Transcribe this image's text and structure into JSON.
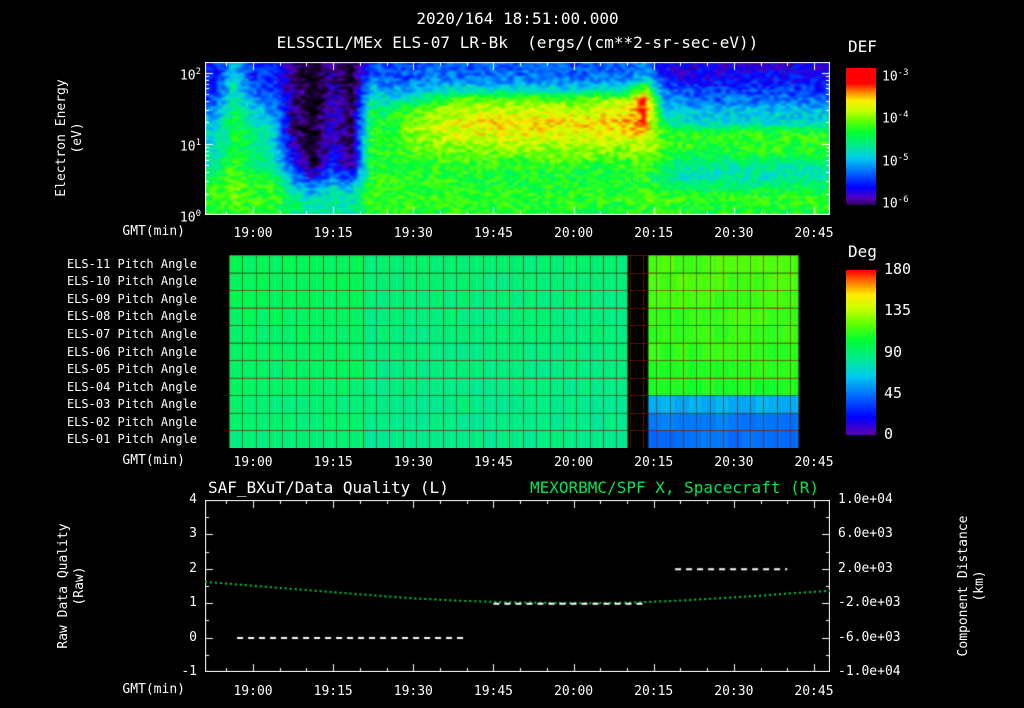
{
  "header": {
    "datetime": "2020/164 18:51:00.000",
    "plot_title": "ELSSCIL/MEx ELS-07 LR-Bk  (ergs/(cm**2-sr-sec-eV))"
  },
  "colors": {
    "background": "#000000",
    "text": "#ffffff",
    "title_green": "#00e64d",
    "curve_green": "#00cc44",
    "quality_white": "#ffffff",
    "grid_red": "#8a1e00"
  },
  "time_axis": {
    "label": "GMT(min)",
    "start": "18:51",
    "end": "20:48",
    "total_minutes": 117,
    "ticks": [
      {
        "t": 9,
        "label": "19:00"
      },
      {
        "t": 24,
        "label": "19:15"
      },
      {
        "t": 39,
        "label": "19:30"
      },
      {
        "t": 54,
        "label": "19:45"
      },
      {
        "t": 69,
        "label": "20:00"
      },
      {
        "t": 84,
        "label": "20:15"
      },
      {
        "t": 99,
        "label": "20:30"
      },
      {
        "t": 114,
        "label": "20:45"
      }
    ],
    "minor_step_min": 5
  },
  "chart_data": [
    {
      "type": "heatmap",
      "title": "ELSSCIL/MEx ELS-07 LR-Bk",
      "units": "ergs/(cm**2-sr-sec-eV)",
      "ylabel": "Electron Energy (eV)",
      "ylabel_lines": [
        "Electron Energy",
        "(eV)"
      ],
      "y_scale": "log",
      "y_range_log10": [
        0,
        2.15
      ],
      "y_ticks": [
        {
          "base": "10",
          "exp": "2",
          "log10": 2
        },
        {
          "base": "10",
          "exp": "1",
          "log10": 1
        },
        {
          "base": "10",
          "exp": "0",
          "log10": 0
        }
      ],
      "colorbar": {
        "label": "DEF",
        "scale": "log",
        "range_log10": [
          -6.1,
          -2.85
        ],
        "ticks": [
          {
            "base": "10",
            "exp": "-3",
            "value": -3
          },
          {
            "base": "10",
            "exp": "-4",
            "value": -4
          },
          {
            "base": "10",
            "exp": "-5",
            "value": -5
          },
          {
            "base": "10",
            "exp": "-6",
            "value": -6
          }
        ]
      },
      "grid_log10_flux": {
        "comment": "log10 DEF, 14 energy rows (top=highest E ~160eV, bottom ~1eV) x 32 time cols over 18:51-20:48",
        "n_time": 32,
        "n_energy": 14,
        "values_rows_top_to_bottom": [
          [
            -5.6,
            -5.0,
            -5.6,
            -5.6,
            -6.0,
            -6.3,
            -6.0,
            -6.3,
            -5.4,
            -5.5,
            -5.5,
            -5.4,
            -5.4,
            -5.4,
            -5.4,
            -5.4,
            -5.4,
            -5.4,
            -5.4,
            -5.4,
            -5.4,
            -5.4,
            -5.2,
            -5.7,
            -5.8,
            -5.8,
            -5.8,
            -5.8,
            -5.8,
            -5.8,
            -5.8,
            -5.8
          ],
          [
            -5.6,
            -4.9,
            -5.6,
            -5.6,
            -6.0,
            -6.3,
            -6.0,
            -6.3,
            -5.3,
            -5.4,
            -5.4,
            -5.3,
            -5.3,
            -5.3,
            -5.3,
            -5.3,
            -5.3,
            -5.3,
            -5.3,
            -5.3,
            -5.3,
            -5.3,
            -5.0,
            -5.6,
            -5.7,
            -5.7,
            -5.7,
            -5.7,
            -5.7,
            -5.7,
            -5.7,
            -5.7
          ],
          [
            -5.5,
            -4.8,
            -5.4,
            -5.5,
            -6.0,
            -6.3,
            -5.9,
            -6.2,
            -5.0,
            -5.2,
            -5.1,
            -5.0,
            -4.9,
            -4.8,
            -4.9,
            -4.9,
            -4.9,
            -4.9,
            -4.9,
            -4.9,
            -4.8,
            -4.8,
            -4.0,
            -5.4,
            -5.5,
            -5.5,
            -5.5,
            -5.5,
            -5.5,
            -5.5,
            -5.5,
            -5.5
          ],
          [
            -5.4,
            -4.7,
            -5.2,
            -5.4,
            -6.0,
            -6.3,
            -5.9,
            -6.2,
            -4.7,
            -4.9,
            -4.7,
            -4.4,
            -4.2,
            -4.1,
            -4.1,
            -4.1,
            -4.1,
            -4.1,
            -4.1,
            -4.1,
            -4.0,
            -3.9,
            -3.3,
            -5.1,
            -5.3,
            -5.3,
            -5.3,
            -5.3,
            -5.3,
            -5.3,
            -5.3,
            -5.3
          ],
          [
            -5.2,
            -4.5,
            -5.0,
            -5.2,
            -6.0,
            -6.3,
            -5.8,
            -6.2,
            -4.5,
            -4.5,
            -4.2,
            -4.0,
            -3.9,
            -3.85,
            -3.8,
            -3.8,
            -3.8,
            -3.8,
            -3.8,
            -3.8,
            -3.7,
            -3.65,
            -3.25,
            -4.9,
            -5.0,
            -5.0,
            -5.0,
            -5.0,
            -5.0,
            -5.0,
            -5.0,
            -5.0
          ],
          [
            -5.0,
            -4.4,
            -4.8,
            -5.0,
            -6.0,
            -6.3,
            -5.8,
            -6.2,
            -4.35,
            -4.35,
            -4.1,
            -3.9,
            -3.75,
            -3.7,
            -3.65,
            -3.65,
            -3.65,
            -3.65,
            -3.65,
            -3.65,
            -3.6,
            -3.55,
            -3.3,
            -4.6,
            -4.9,
            -4.9,
            -4.9,
            -4.9,
            -4.9,
            -4.9,
            -4.9,
            -4.9
          ],
          [
            -4.9,
            -4.4,
            -4.6,
            -4.9,
            -6.0,
            -6.3,
            -5.8,
            -6.2,
            -4.3,
            -4.3,
            -4.0,
            -3.9,
            -3.8,
            -3.75,
            -3.7,
            -3.7,
            -3.7,
            -3.7,
            -3.7,
            -3.7,
            -3.65,
            -3.6,
            -3.6,
            -4.3,
            -4.3,
            -4.35,
            -4.3,
            -4.3,
            -4.3,
            -4.3,
            -4.3,
            -4.3
          ],
          [
            -4.9,
            -4.4,
            -4.6,
            -4.9,
            -5.9,
            -6.3,
            -5.8,
            -6.2,
            -4.3,
            -4.3,
            -4.1,
            -4.0,
            -3.95,
            -3.9,
            -3.9,
            -3.9,
            -3.9,
            -3.9,
            -3.9,
            -3.9,
            -3.9,
            -3.9,
            -3.8,
            -4.2,
            -4.25,
            -4.3,
            -4.25,
            -4.25,
            -4.25,
            -4.25,
            -4.25,
            -4.25
          ],
          [
            -4.8,
            -4.3,
            -4.6,
            -4.8,
            -5.8,
            -6.3,
            -5.7,
            -6.1,
            -4.3,
            -4.3,
            -4.2,
            -4.2,
            -4.15,
            -4.1,
            -4.1,
            -4.1,
            -4.1,
            -4.1,
            -4.1,
            -4.1,
            -4.1,
            -4.1,
            -4.0,
            -4.3,
            -4.4,
            -4.45,
            -4.4,
            -4.4,
            -4.4,
            -4.4,
            -4.4,
            -4.4
          ],
          [
            -4.7,
            -4.2,
            -4.6,
            -4.7,
            -5.5,
            -6.2,
            -5.6,
            -6.0,
            -4.4,
            -4.35,
            -4.3,
            -4.3,
            -4.3,
            -4.3,
            -4.3,
            -4.3,
            -4.3,
            -4.3,
            -4.3,
            -4.3,
            -4.3,
            -4.3,
            -4.2,
            -4.5,
            -4.7,
            -4.75,
            -4.7,
            -4.7,
            -4.7,
            -4.7,
            -4.7,
            -4.7
          ],
          [
            -4.5,
            -4.15,
            -4.4,
            -4.5,
            -5.2,
            -5.8,
            -5.3,
            -5.6,
            -4.3,
            -4.3,
            -4.3,
            -4.3,
            -4.3,
            -4.3,
            -4.4,
            -4.4,
            -4.4,
            -4.4,
            -4.4,
            -4.4,
            -4.4,
            -4.4,
            -4.3,
            -4.6,
            -4.8,
            -4.85,
            -4.8,
            -4.8,
            -4.8,
            -4.8,
            -4.8,
            -4.8
          ],
          [
            -4.3,
            -4.1,
            -4.3,
            -4.3,
            -4.9,
            -5.2,
            -4.9,
            -5.1,
            -4.2,
            -4.3,
            -4.3,
            -4.3,
            -4.3,
            -4.3,
            -4.35,
            -4.35,
            -4.35,
            -4.35,
            -4.35,
            -4.35,
            -4.35,
            -4.35,
            -4.3,
            -4.4,
            -4.5,
            -4.55,
            -4.5,
            -4.5,
            -4.5,
            -4.5,
            -4.5,
            -4.5
          ],
          [
            -4.2,
            -4.1,
            -4.2,
            -4.2,
            -4.6,
            -4.9,
            -4.7,
            -4.8,
            -4.2,
            -4.25,
            -4.25,
            -4.25,
            -4.25,
            -4.25,
            -4.25,
            -4.25,
            -4.25,
            -4.25,
            -4.25,
            -4.25,
            -4.25,
            -4.25,
            -4.2,
            -4.2,
            -4.25,
            -4.3,
            -4.25,
            -4.25,
            -4.25,
            -4.25,
            -4.25,
            -4.25
          ],
          [
            -4.3,
            -4.2,
            -4.3,
            -4.3,
            -4.6,
            -4.8,
            -4.7,
            -4.8,
            -4.3,
            -4.3,
            -4.3,
            -4.3,
            -4.3,
            -4.3,
            -4.35,
            -4.35,
            -4.35,
            -4.35,
            -4.35,
            -4.35,
            -4.35,
            -4.35,
            -4.3,
            -4.3,
            -4.35,
            -4.4,
            -4.35,
            -4.35,
            -4.35,
            -4.35,
            -4.35,
            -4.35
          ]
        ]
      }
    },
    {
      "type": "heatmap",
      "title": "ELS Pitch Angles",
      "colorbar": {
        "label": "Deg",
        "range": [
          0,
          180
        ],
        "ticks": [
          180,
          135,
          90,
          45,
          0
        ]
      },
      "data_span_min": [
        4.5,
        111
      ],
      "gap_min": [
        79,
        83
      ],
      "rows": [
        {
          "label": "ELS-11 Pitch Angle",
          "segments_min_deg": [
            [
              4.5,
              30,
              95
            ],
            [
              30,
              79,
              89
            ],
            [
              83,
              111,
              117
            ]
          ]
        },
        {
          "label": "ELS-10 Pitch Angle",
          "segments_min_deg": [
            [
              4.5,
              30,
              94
            ],
            [
              30,
              79,
              88
            ],
            [
              83,
              111,
              116
            ]
          ]
        },
        {
          "label": "ELS-09 Pitch Angle",
          "segments_min_deg": [
            [
              4.5,
              30,
              93
            ],
            [
              30,
              79,
              88
            ],
            [
              83,
              111,
              115
            ]
          ]
        },
        {
          "label": "ELS-08 Pitch Angle",
          "segments_min_deg": [
            [
              4.5,
              30,
              93
            ],
            [
              30,
              79,
              87
            ],
            [
              83,
              111,
              114
            ]
          ]
        },
        {
          "label": "ELS-07 Pitch Angle",
          "segments_min_deg": [
            [
              4.5,
              30,
              92
            ],
            [
              30,
              79,
              87
            ],
            [
              83,
              111,
              113
            ]
          ]
        },
        {
          "label": "ELS-06 Pitch Angle",
          "segments_min_deg": [
            [
              4.5,
              30,
              92
            ],
            [
              30,
              79,
              86
            ],
            [
              83,
              111,
              112
            ]
          ]
        },
        {
          "label": "ELS-05 Pitch Angle",
          "segments_min_deg": [
            [
              4.5,
              30,
              91
            ],
            [
              30,
              79,
              86
            ],
            [
              83,
              111,
              111
            ]
          ]
        },
        {
          "label": "ELS-04 Pitch Angle",
          "segments_min_deg": [
            [
              4.5,
              30,
              90
            ],
            [
              30,
              79,
              85
            ],
            [
              83,
              111,
              108
            ]
          ]
        },
        {
          "label": "ELS-03 Pitch Angle",
          "segments_min_deg": [
            [
              4.5,
              30,
              89
            ],
            [
              30,
              79,
              85
            ],
            [
              83,
              111,
              58
            ]
          ]
        },
        {
          "label": "ELS-02 Pitch Angle",
          "segments_min_deg": [
            [
              4.5,
              30,
              89
            ],
            [
              30,
              79,
              84
            ],
            [
              83,
              111,
              46
            ]
          ]
        },
        {
          "label": "ELS-01 Pitch Angle",
          "segments_min_deg": [
            [
              4.5,
              30,
              88
            ],
            [
              30,
              79,
              84
            ],
            [
              83,
              111,
              44
            ]
          ]
        }
      ]
    },
    {
      "type": "line",
      "title_left": "SAF_BXuT/Data Quality (L)",
      "title_right": "MEXORBMC/SPF X, Spacecraft (R)",
      "ylabel_left": "Raw Data Quality (Raw)",
      "ylabel_left_lines": [
        "Raw Data Quality",
        "(Raw)"
      ],
      "ylabel_right": "Component Distance (km)",
      "ylabel_right_lines": [
        "Component Distance",
        "(km)"
      ],
      "y_left_range": [
        -1,
        4
      ],
      "y_left_ticks": [
        4,
        3,
        2,
        1,
        0,
        -1
      ],
      "y_right_range_km": [
        -10000,
        10000
      ],
      "y_right_ticks": [
        "1.0e+04",
        "6.0e+03",
        "2.0e+03",
        "-2.0e+03",
        "-6.0e+03",
        "-1.0e+04"
      ],
      "quality_segments": [
        {
          "y": 0,
          "t0": 6,
          "t1": 49
        },
        {
          "y": 1,
          "t0": 54,
          "t1": 82
        },
        {
          "y": 2,
          "t0": 88,
          "t1": 109
        }
      ],
      "spacecraft_x_km": [
        [
          0,
          480
        ],
        [
          8,
          80
        ],
        [
          16,
          -320
        ],
        [
          24,
          -720
        ],
        [
          32,
          -1120
        ],
        [
          40,
          -1480
        ],
        [
          48,
          -1720
        ],
        [
          56,
          -1880
        ],
        [
          64,
          -1960
        ],
        [
          72,
          -2000
        ],
        [
          80,
          -1920
        ],
        [
          88,
          -1720
        ],
        [
          96,
          -1440
        ],
        [
          104,
          -1120
        ],
        [
          110,
          -840
        ],
        [
          117,
          -560
        ]
      ]
    }
  ]
}
